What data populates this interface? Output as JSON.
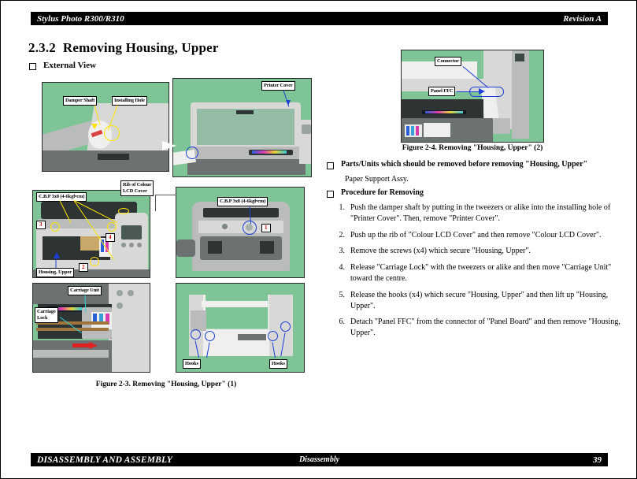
{
  "header": {
    "left": "Stylus Photo R300/R310",
    "right": "Revision A"
  },
  "footer": {
    "left": "DISASSEMBLY AND ASSEMBLY",
    "center": "Disassembly",
    "page": "39"
  },
  "section": {
    "number": "2.3.2",
    "title": "Removing Housing, Upper",
    "external_view": "External View"
  },
  "figures": {
    "fig23": "Figure 2-3.  Removing \"Housing, Upper\" (1)",
    "fig24": "Figure 2-4.  Removing \"Housing, Upper\" (2)"
  },
  "labels": {
    "damper_shaft": "Damper Shaft",
    "installing_hole": "Installing Hole",
    "printer_cover": "Printer Cover",
    "screw_spec": "C.B.P 3x8 (4-6kgf•cm)",
    "rib_lcd_cover": "Rib of Colour\nLCD Cover",
    "housing_upper": "Housing, Upper",
    "carriage_unit": "Carriage Unit",
    "carriage_lock": "Carriage\nLock",
    "hooks_left": "Hooks",
    "hooks_right": "Hooks",
    "connector": "Connector",
    "panel_ffc": "Panel FFC"
  },
  "callouts": {
    "one": "1",
    "two": "2",
    "three": "3",
    "four": "4"
  },
  "parts_section": {
    "heading": "Parts/Units which should be removed before removing \"Housing, Upper\"",
    "item": "Paper Support Assy."
  },
  "procedure": {
    "heading": "Procedure for Removing",
    "steps": [
      {
        "n": "1.",
        "text": "Push the damper shaft by putting in the tweezers or alike into the installing hole of \"Printer Cover\". Then, remove \"Printer Cover\"."
      },
      {
        "n": "2.",
        "text": "Push up the rib of \"Colour LCD Cover\" and then remove \"Colour LCD Cover\"."
      },
      {
        "n": "3.",
        "text": "Remove the screws (x4) which secure \"Housing, Upper\"."
      },
      {
        "n": "4.",
        "text": "Release \"Carriage Lock\" with the tweezers or alike and then move \"Carriage Unit\" toward the centre."
      },
      {
        "n": "5.",
        "text": "Release the hooks (x4) which secure \"Housing, Upper\" and then lift up \"Housing, Upper\"."
      },
      {
        "n": "6.",
        "text": "Detach \"Panel FFC\" from the connector of \"Panel Board\" and then remove \"Housing, Upper\"."
      }
    ]
  },
  "colors": {
    "photo_backdrop": "#7fc496",
    "callout_yellow": "#ffe400",
    "callout_blue": "#1b3fd8",
    "callout_red": "#d00000",
    "bar": "#000000"
  }
}
